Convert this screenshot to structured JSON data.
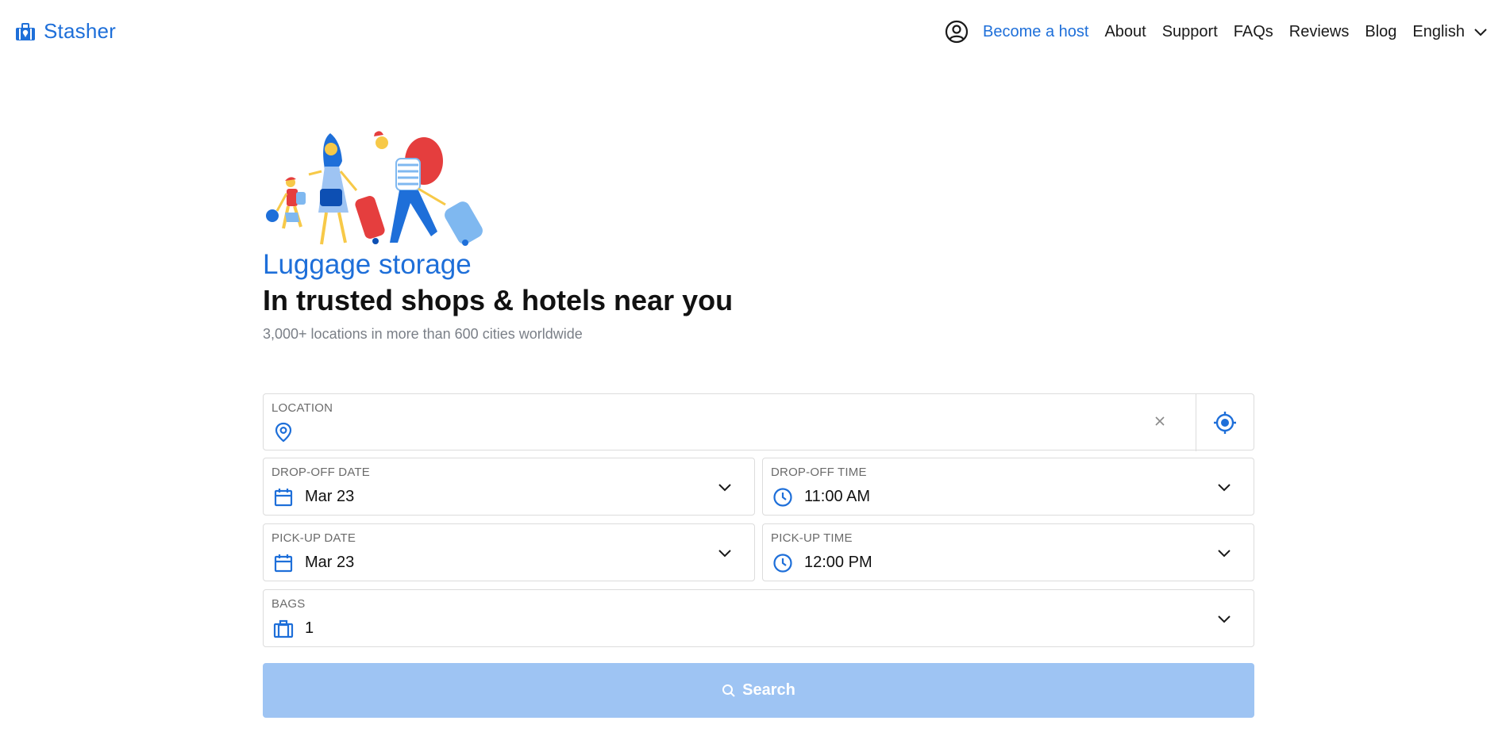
{
  "brand": {
    "name": "Stasher",
    "accent": "#1e6fd9"
  },
  "nav": {
    "account_icon": "account-circle-icon",
    "items": [
      {
        "label": "Become a host"
      },
      {
        "label": "About"
      },
      {
        "label": "Support"
      },
      {
        "label": "FAQs"
      },
      {
        "label": "Reviews"
      },
      {
        "label": "Blog"
      }
    ],
    "language": "English"
  },
  "hero": {
    "eyebrow": "Luggage storage",
    "headline": "In trusted shops & hotels near you",
    "subhead": "3,000+ locations in more than 600 cities worldwide"
  },
  "form": {
    "location": {
      "label": "LOCATION",
      "value": "",
      "placeholder": ""
    },
    "dropoff_date": {
      "label": "DROP-OFF DATE",
      "value": "Mar 23"
    },
    "dropoff_time": {
      "label": "DROP-OFF TIME",
      "value": "11:00 AM"
    },
    "pickup_date": {
      "label": "PICK-UP DATE",
      "value": "Mar 23"
    },
    "pickup_time": {
      "label": "PICK-UP TIME",
      "value": "12:00 PM"
    },
    "bags": {
      "label": "BAGS",
      "value": "1"
    },
    "search_label": "Search",
    "search_button_color": "#9ec4f3"
  }
}
